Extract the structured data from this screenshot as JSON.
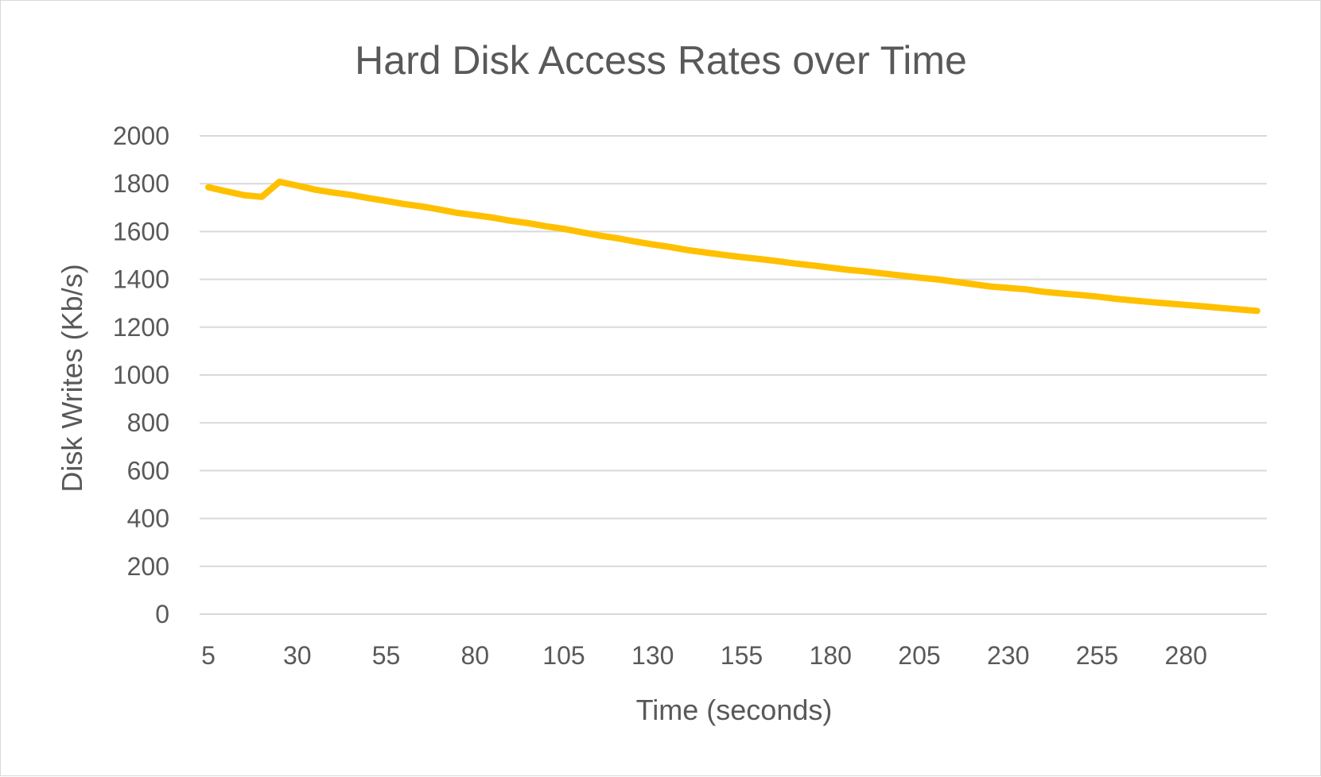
{
  "chart_data": {
    "type": "line",
    "title": "Hard Disk Access Rates over Time",
    "xlabel": "Time (seconds)",
    "ylabel": "Disk Writes (Kb/s)",
    "ylim": [
      0,
      2000
    ],
    "y_ticks": [
      0,
      200,
      400,
      600,
      800,
      1000,
      1200,
      1400,
      1600,
      1800,
      2000
    ],
    "x_tick_labels": [
      "5",
      "30",
      "55",
      "80",
      "105",
      "130",
      "155",
      "180",
      "205",
      "230",
      "255",
      "280"
    ],
    "grid": "horizontal",
    "legend": "none",
    "x": [
      5,
      10,
      15,
      20,
      25,
      30,
      35,
      40,
      45,
      50,
      55,
      60,
      65,
      70,
      75,
      80,
      85,
      90,
      95,
      100,
      105,
      110,
      115,
      120,
      125,
      130,
      135,
      140,
      145,
      150,
      155,
      160,
      165,
      170,
      175,
      180,
      185,
      190,
      195,
      200,
      205,
      210,
      215,
      220,
      225,
      230,
      235,
      240,
      245,
      250,
      255,
      260,
      265,
      270,
      275,
      280,
      285,
      290,
      295,
      300
    ],
    "series": [
      {
        "color": "#FFC000",
        "values": [
          1785,
          1768,
          1752,
          1745,
          1808,
          1792,
          1775,
          1763,
          1753,
          1740,
          1728,
          1715,
          1705,
          1692,
          1678,
          1668,
          1658,
          1645,
          1635,
          1622,
          1611,
          1597,
          1583,
          1572,
          1558,
          1546,
          1535,
          1522,
          1512,
          1502,
          1493,
          1485,
          1476,
          1466,
          1458,
          1449,
          1440,
          1433,
          1424,
          1416,
          1407,
          1400,
          1390,
          1380,
          1370,
          1364,
          1358,
          1348,
          1341,
          1335,
          1328,
          1319,
          1312,
          1305,
          1299,
          1293,
          1287,
          1280,
          1274,
          1268
        ]
      }
    ]
  }
}
